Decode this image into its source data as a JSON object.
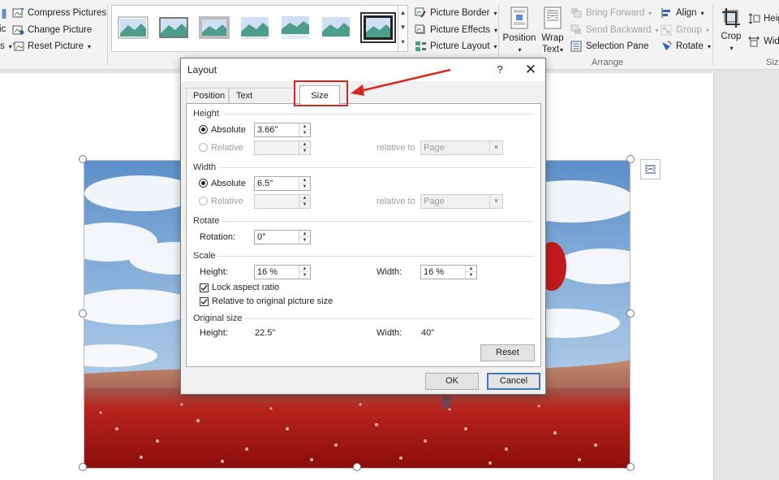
{
  "ribbon": {
    "adjust": {
      "compress": "Compress Pictures",
      "change": "Change Picture",
      "reset": "Reset Picture",
      "partial_left_1": "ic",
      "partial_left_2": "s"
    },
    "picture_styles": {
      "count": 8,
      "selected_index": 7
    },
    "style_options": {
      "border": "Picture Border",
      "effects": "Picture Effects",
      "layout": "Picture Layout"
    },
    "arrange": {
      "position": "Position",
      "wrap_line1": "Wrap",
      "wrap_line2": "Text",
      "bring_forward": "Bring Forward",
      "send_backward": "Send Backward",
      "selection_pane": "Selection Pane",
      "align": "Align",
      "group": "Group",
      "rotate": "Rotate",
      "group_label": "Arrange"
    },
    "size": {
      "crop": "Crop",
      "height_partial": "Heig",
      "width_partial": "Wid",
      "group_label_partial": "Siz"
    }
  },
  "dialog": {
    "title": "Layout",
    "help": "?",
    "close": "✕",
    "tabs": [
      {
        "label": "Position",
        "active": false
      },
      {
        "label": "Text Wrapping",
        "active": false
      },
      {
        "label": "Size",
        "active": true
      }
    ],
    "height": {
      "title": "Height",
      "absolute_label": "Absolute",
      "absolute_value": "3.66\"",
      "relative_label": "Relative",
      "relative_value": "",
      "relative_to_label": "relative to",
      "relative_to_value": "Page"
    },
    "width": {
      "title": "Width",
      "absolute_label": "Absolute",
      "absolute_value": "6.5\"",
      "relative_label": "Relative",
      "relative_value": "",
      "relative_to_label": "relative to",
      "relative_to_value": "Page"
    },
    "rotate": {
      "title": "Rotate",
      "rotation_label": "Rotation:",
      "rotation_value": "0°"
    },
    "scale": {
      "title": "Scale",
      "height_label": "Height:",
      "height_value": "16 %",
      "width_label": "Width:",
      "width_value": "16 %",
      "lock_aspect": "Lock aspect ratio",
      "lock_aspect_checked": true,
      "relative_original": "Relative to original picture size",
      "relative_original_checked": true
    },
    "original": {
      "title": "Original size",
      "height_label": "Height:",
      "height_value": "22.5\"",
      "width_label": "Width:",
      "width_value": "40\""
    },
    "buttons": {
      "reset": "Reset",
      "ok": "OK",
      "cancel": "Cancel"
    }
  },
  "colors": {
    "annotation_red": "#d9251c",
    "default_button_border": "#3b79c8",
    "ribbon_bg": "#f3f3f3",
    "dialog_bg": "#f0f0f0"
  }
}
